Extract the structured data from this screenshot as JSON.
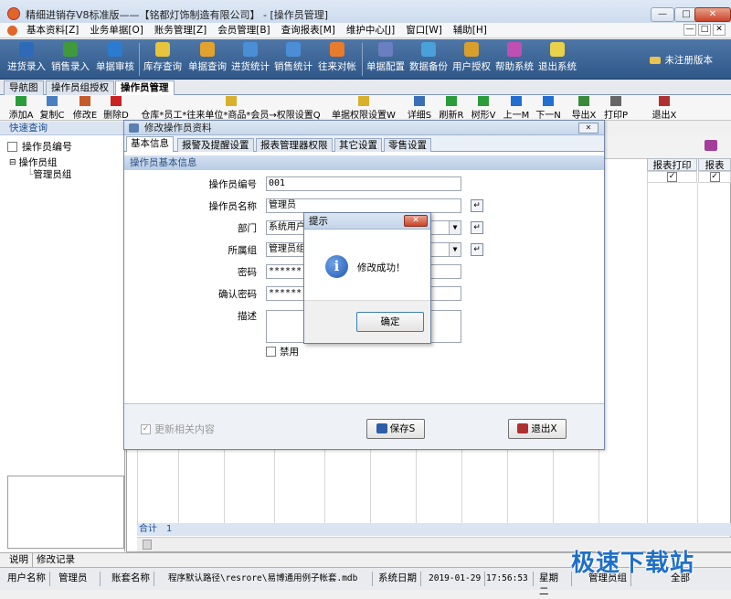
{
  "window": {
    "title": "精细进销存V8标准版——【铭都灯饰制造有限公司】 - [操作员管理]",
    "controls": [
      "—",
      "□",
      "✕"
    ]
  },
  "menu": {
    "items": [
      "基本资料[Z]",
      "业务单据[O]",
      "账务管理[Z]",
      "会员管理[B]",
      "查询报表[M]",
      "维护中心[J]",
      "窗口[W]",
      "辅助[H]"
    ],
    "mdi_controls": [
      "—",
      "□",
      "✕"
    ]
  },
  "toolbar": {
    "buttons": [
      "进货录入",
      "销售录入",
      "单据审核",
      "库存查询",
      "单据查询",
      "进货统计",
      "销售统计",
      "往来对帐",
      "单据配置",
      "数据备份",
      "用户授权",
      "帮助系统",
      "退出系统"
    ],
    "unregistered": "未注册版本",
    "icon_colors": [
      "#2d6ab7",
      "#3e9a3a",
      "#2b7bd0",
      "#e6c43c",
      "#e3a22c",
      "#4a8fd6",
      "#4a8fd6",
      "#e87c2a",
      "#6a7fc0",
      "#4aa0d8",
      "#d89f2c",
      "#c04fb4",
      "#e8d24a"
    ]
  },
  "tabs": {
    "items": [
      "导航图",
      "操作员组授权",
      "操作员管理"
    ],
    "active_index": 2
  },
  "subtoolbar": {
    "buttons": [
      "添加A",
      "复制C",
      "修改E",
      "删除D",
      "仓库*员工*往来单位*商品*会员→权限设置Q",
      "单据权限设置W",
      "详细S",
      "刷新R",
      "树形V",
      "上一M",
      "下一N",
      "导出X",
      "打印P",
      "退出X"
    ],
    "icon_colors": [
      "#2a9d3a",
      "#4a7fc1",
      "#c55a2a",
      "#cc2222",
      "#d8b02c",
      "#d8b02c",
      "#3b6fb5",
      "#2a9d3a",
      "#2a9d3a",
      "#1f6fd0",
      "#1f6fd0",
      "#3a8a3a",
      "#666666",
      "#b03030"
    ]
  },
  "left": {
    "quick_query": "快速查询",
    "filter_label": "操作员编号",
    "tree": {
      "root": "操作员组",
      "children": [
        "管理员组"
      ]
    }
  },
  "grid": {
    "headers": [
      "报表打印",
      "报表"
    ],
    "row_values": [
      "✓",
      "✓"
    ],
    "sum_label": "合计",
    "sum_value": "1"
  },
  "notes": {
    "items": [
      "说明",
      "修改记录"
    ]
  },
  "status": {
    "user_label": "用户名称",
    "user_value": "管理员",
    "book_label": "账套名称",
    "book_value": "程序默认路径\\resrore\\易博通用例子帐套.mdb",
    "date_label": "系统日期",
    "date_value": "2019-01-29",
    "time_value": "17:56:53",
    "weekday": "星期二",
    "group_value": "管理员组",
    "scope_value": "全部"
  },
  "dialog": {
    "title": "修改操作员资料",
    "tabs": [
      "基本信息",
      "报警及提醒设置",
      "报表管理器权限",
      "其它设置",
      "零售设置"
    ],
    "section_header": "操作员基本信息",
    "fields": {
      "operator_id": {
        "label": "操作员编号",
        "value": "001"
      },
      "operator_name": {
        "label": "操作员名称",
        "value": "管理员"
      },
      "department": {
        "label": "部门",
        "value": "系统用户"
      },
      "group": {
        "label": "所属组",
        "value": "管理员组"
      },
      "password": {
        "label": "密码",
        "value": "******"
      },
      "confirm_password": {
        "label": "确认密码",
        "value": "******"
      },
      "description": {
        "label": "描述",
        "value": ""
      }
    },
    "disable_label": "禁用",
    "update_related_label": "更新相关内容",
    "save_button": "保存S",
    "exit_button": "退出X"
  },
  "messagebox": {
    "title": "提示",
    "message": "修改成功！",
    "ok_button": "确定",
    "close": "✕"
  },
  "watermark": "极速下载站"
}
